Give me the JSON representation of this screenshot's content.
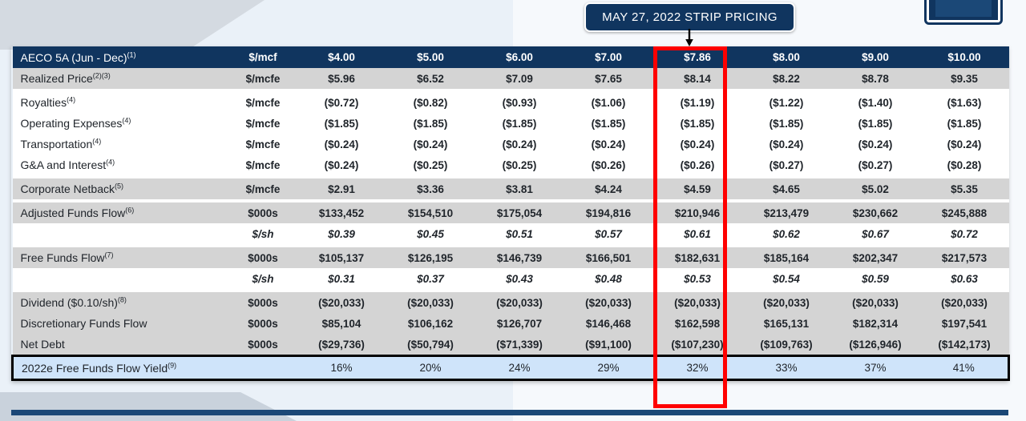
{
  "callout": {
    "label": "MAY 27, 2022 STRIP PRICING",
    "arrow_icon": "down-arrow-icon",
    "accent_color": "#10355f"
  },
  "highlight": {
    "color": "#ff0000",
    "column_index": 5,
    "column_value": "$7.86"
  },
  "table": {
    "columns": [
      "$4.00",
      "$5.00",
      "$6.00",
      "$7.00",
      "$7.86",
      "$8.00",
      "$9.00",
      "$10.00"
    ],
    "header": {
      "label": "AECO 5A (Jun - Dec)",
      "footnote": "(1)",
      "unit": "$/mcf"
    },
    "rows": [
      {
        "label": "Realized Price",
        "footnote": "(2)(3)",
        "unit": "$/mcfe",
        "style": "shade",
        "values": [
          "$5.96",
          "$6.52",
          "$7.09",
          "$7.65",
          "$8.14",
          "$8.22",
          "$8.78",
          "$9.35"
        ]
      },
      {
        "label": "Royalties",
        "footnote": "(4)",
        "unit": "$/mcfe",
        "style": "plain",
        "values": [
          "($0.72)",
          "($0.82)",
          "($0.93)",
          "($1.06)",
          "($1.19)",
          "($1.22)",
          "($1.40)",
          "($1.63)"
        ]
      },
      {
        "label": "Operating Expenses",
        "footnote": "(4)",
        "unit": "$/mcfe",
        "style": "plain",
        "values": [
          "($1.85)",
          "($1.85)",
          "($1.85)",
          "($1.85)",
          "($1.85)",
          "($1.85)",
          "($1.85)",
          "($1.85)"
        ]
      },
      {
        "label": "Transportation",
        "footnote": "(4)",
        "unit": "$/mcfe",
        "style": "plain",
        "values": [
          "($0.24)",
          "($0.24)",
          "($0.24)",
          "($0.24)",
          "($0.24)",
          "($0.24)",
          "($0.24)",
          "($0.24)"
        ]
      },
      {
        "label": "G&A and Interest",
        "footnote": "(4)",
        "unit": "$/mcfe",
        "style": "plain",
        "values": [
          "($0.24)",
          "($0.25)",
          "($0.25)",
          "($0.26)",
          "($0.26)",
          "($0.27)",
          "($0.27)",
          "($0.28)"
        ]
      },
      {
        "label": "Corporate Netback",
        "footnote": "(5)",
        "unit": "$/mcfe",
        "style": "shade",
        "values": [
          "$2.91",
          "$3.36",
          "$3.81",
          "$4.24",
          "$4.59",
          "$4.65",
          "$5.02",
          "$5.35"
        ]
      },
      {
        "label": "Adjusted Funds Flow",
        "footnote": "(6)",
        "unit": "$000s",
        "style": "shade",
        "values": [
          "$133,452",
          "$154,510",
          "$175,054",
          "$194,816",
          "$210,946",
          "$213,479",
          "$230,662",
          "$245,888"
        ]
      },
      {
        "label": "",
        "footnote": "",
        "unit": "$/sh",
        "style": "italic",
        "values": [
          "$0.39",
          "$0.45",
          "$0.51",
          "$0.57",
          "$0.61",
          "$0.62",
          "$0.67",
          "$0.72"
        ]
      },
      {
        "label": "Free Funds Flow",
        "footnote": "(7)",
        "unit": "$000s",
        "style": "shade",
        "values": [
          "$105,137",
          "$126,195",
          "$146,739",
          "$166,501",
          "$182,631",
          "$185,164",
          "$202,347",
          "$217,573"
        ]
      },
      {
        "label": "",
        "footnote": "",
        "unit": "$/sh",
        "style": "italic",
        "values": [
          "$0.31",
          "$0.37",
          "$0.43",
          "$0.48",
          "$0.53",
          "$0.54",
          "$0.59",
          "$0.63"
        ]
      },
      {
        "label": "Dividend ($0.10/sh)",
        "footnote": "(8)",
        "unit": "$000s",
        "style": "shade",
        "values": [
          "($20,033)",
          "($20,033)",
          "($20,033)",
          "($20,033)",
          "($20,033)",
          "($20,033)",
          "($20,033)",
          "($20,033)"
        ]
      },
      {
        "label": "Discretionary Funds Flow",
        "footnote": "",
        "unit": "$000s",
        "style": "shade",
        "values": [
          "$85,104",
          "$106,162",
          "$126,707",
          "$146,468",
          "$162,598",
          "$165,131",
          "$182,314",
          "$197,541"
        ]
      },
      {
        "label": "Net Debt",
        "footnote": "",
        "unit": "$000s",
        "style": "shade",
        "values": [
          "($29,736)",
          "($50,794)",
          "($71,339)",
          "($91,100)",
          "($107,230)",
          "($109,763)",
          "($126,946)",
          "($142,173)"
        ]
      }
    ],
    "footer_row": {
      "label": "2022e Free Funds Flow Yield",
      "footnote": "(9)",
      "unit": "",
      "values": [
        "16%",
        "20%",
        "24%",
        "29%",
        "32%",
        "33%",
        "37%",
        "41%"
      ]
    }
  }
}
